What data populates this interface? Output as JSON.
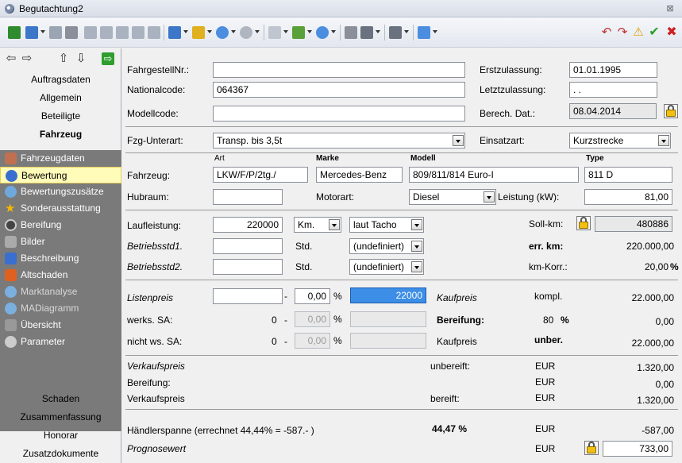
{
  "window": {
    "title": "Begutachtung2",
    "close_symbol": "⊠"
  },
  "sidebar": {
    "top_items": [
      "Auftragsdaten",
      "Allgemein",
      "Beteiligte",
      "Fahrzeug"
    ],
    "dark_items": [
      {
        "label": "Fahrzeugdaten",
        "icon": "car-icon",
        "color": "#c07050"
      },
      {
        "label": "Bewertung",
        "icon": "coins-icon",
        "color": "#3a6fd0"
      },
      {
        "label": "Bewertungszusätze",
        "icon": "gear-icon",
        "color": "#6fa8dc"
      },
      {
        "label": "Sonderausstattung",
        "icon": "star-icon",
        "color": "#f5b800"
      },
      {
        "label": "Bereifung",
        "icon": "tire-icon",
        "color": "#444444"
      },
      {
        "label": "Bilder",
        "icon": "camera-icon",
        "color": "#aaaaaa"
      },
      {
        "label": "Beschreibung",
        "icon": "document-icon",
        "color": "#3a6fd0"
      },
      {
        "label": "Altschaden",
        "icon": "note-icon",
        "color": "#e06020"
      },
      {
        "label": "Marktanalyse",
        "icon": "chart-icon",
        "color": "#7ab0e0"
      },
      {
        "label": "MADiagramm",
        "icon": "diagram-icon",
        "color": "#7ab0e0"
      },
      {
        "label": "Übersicht",
        "icon": "building-icon",
        "color": "#999999"
      },
      {
        "label": "Parameter",
        "icon": "settings-icon",
        "color": "#cccccc"
      }
    ],
    "bottom_items": [
      "Schaden",
      "Zusammenfassung",
      "Honorar",
      "Zusatzdokumente"
    ]
  },
  "form": {
    "fahrgestellnr_label": "FahrgestellNr.:",
    "fahrgestellnr_value": "",
    "nationalcode_label": "Nationalcode:",
    "nationalcode_value": "064367",
    "modellcode_label": "Modellcode:",
    "modellcode_value": "",
    "erstzulassung_label": "Erstzulassung:",
    "erstzulassung_value": "01.01.1995",
    "letztzulassung_label": "Letztzulassung:",
    "letztzulassung_value": ". .",
    "berech_label": "Berech. Dat.:",
    "berech_value": "08.04.2014",
    "fzg_unterart_label": "Fzg-Unterart:",
    "fzg_unterart_value": "Transp. bis 3,5t",
    "einsatzart_label": "Einsatzart:",
    "einsatzart_value": "Kurzstrecke",
    "col_art": "Art",
    "col_marke": "Marke",
    "col_modell": "Modell",
    "col_type": "Type",
    "fahrzeug_label": "Fahrzeug:",
    "art_value": "LKW/F/P/2tg./",
    "marke_value": "Mercedes-Benz",
    "modell_value": "809/811/814 Euro-I",
    "type_value": "811 D",
    "hubraum_label": "Hubraum:",
    "hubraum_value": "",
    "motorart_label": "Motorart:",
    "motorart_value": "Diesel",
    "leistung_label": "Leistung (kW):",
    "leistung_value": "81,00",
    "laufleistung_label": "Laufleistung:",
    "laufleistung_value": "220000",
    "laufleistung_unit": "Km.",
    "laufleistung_source": "laut Tacho",
    "soll_km_label": "Soll-km:",
    "soll_km_value": "480886",
    "betrieb1_label": "Betriebsstd1.",
    "betrieb1_value": "",
    "betrieb1_unit": "Std.",
    "betrieb1_source": "(undefiniert)",
    "err_km_label": "err. km:",
    "err_km_value": "220.000,00",
    "betrieb2_label": "Betriebsstd2.",
    "betrieb2_value": "",
    "betrieb2_unit": "Std.",
    "betrieb2_source": "(undefiniert)",
    "km_korr_label": "km-Korr.:",
    "km_korr_value": "20,00",
    "km_korr_unit": "%",
    "listenpreis_label": "Listenpreis",
    "listenpreis_value": "",
    "minus": "-",
    "pct": "%",
    "listen_pct": "0,00",
    "kaufpreis_value": "22000",
    "kaufpreis_label": "Kaufpreis",
    "kompl_label": "kompl.",
    "kompl_value": "22.000,00",
    "werks_label": "werks. SA:",
    "werks_zero": "0",
    "werks_pct": "0,00",
    "werks_value": "",
    "bereifung_label": "Bereifung:",
    "bereifung_pct": "80",
    "bereifung_value": "0,00",
    "nicht_label": "nicht ws. SA:",
    "nicht_zero": "0",
    "nicht_pct": "0,00",
    "nicht_value": "",
    "kaufpreis2_label": "Kaufpreis",
    "unber_label": "unber.",
    "unber_value": "22.000,00",
    "verkaufspreis_label": "Verkaufspreis",
    "unbereift_label": "unbereift:",
    "eur": "EUR",
    "verkauf_unbereift_value": "1.320,00",
    "bereifung2_label": "Bereifung:",
    "bereifung2_value": "0,00",
    "verkaufspreis2_label": "Verkaufspreis",
    "bereift_label": "bereift:",
    "verkauf_bereift_value": "1.320,00",
    "haendler_label": "Händlerspanne (errechnet 44,44% = -587.- )",
    "haendler_pct": "44,47 %",
    "haendler_value": "-587,00",
    "prognose_label": "Prognosewert",
    "prognose_value": "733,00"
  }
}
